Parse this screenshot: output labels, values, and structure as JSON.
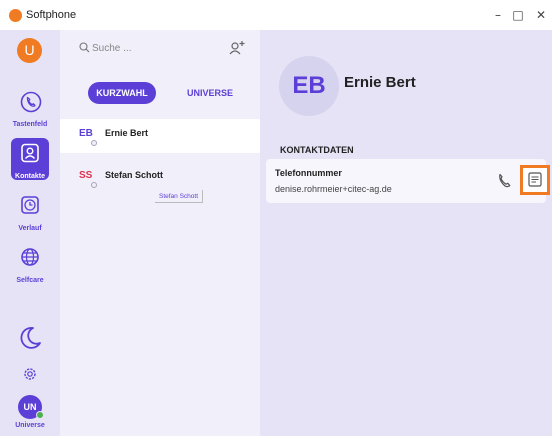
{
  "app": {
    "title": "Softphone"
  },
  "window": {
    "minimize": "–",
    "maximize": "□",
    "close": "✕"
  },
  "sidebar": {
    "profile_initial": "U",
    "items": [
      {
        "label": "Tastenfeld",
        "icon": "phone-circle-icon"
      },
      {
        "label": "Kontakte",
        "icon": "contacts-icon"
      },
      {
        "label": "Verlauf",
        "icon": "clock-icon"
      },
      {
        "label": "Selfcare",
        "icon": "globe-icon"
      }
    ],
    "user_initials": "UN",
    "user_label": "Universe"
  },
  "list": {
    "search_placeholder": "Suche ...",
    "tabs": [
      "KURZWAHL",
      "UNIVERSE"
    ],
    "contacts": [
      {
        "initials": "EB",
        "name": "Ernie Bert"
      },
      {
        "initials": "SS",
        "name": "Stefan Schott"
      }
    ],
    "tooltip": "Stefan Schott"
  },
  "detail": {
    "initials": "EB",
    "name": "Ernie Bert",
    "section_title": "KONTAKTDATEN",
    "field_label": "Telefonnummer",
    "field_value": "denise.rohrmeier+citec-ag.de"
  },
  "colors": {
    "accent": "#5c3fd6",
    "brand": "#f07b22",
    "sidebar_bg": "#e6e3f6",
    "presence": "#4caf50"
  }
}
